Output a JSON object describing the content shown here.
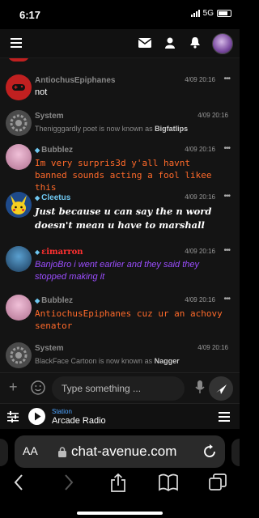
{
  "status_bar": {
    "time": "6:17",
    "network": "5G"
  },
  "header": {
    "menu_icon": "hamburger-icon",
    "icons": [
      "mail-icon",
      "user-icon",
      "bell-icon"
    ],
    "avatar": "user-avatar"
  },
  "messages": [
    {
      "name": "AntiochusEpiphanes",
      "time": "4/09 20:16",
      "text": "not",
      "text_color": "#ffffff",
      "avatar_color": "#c02020",
      "gem": false
    },
    {
      "name": "System",
      "time": "4/09 20:16",
      "text": "Thenigggardly poet is now known as ",
      "text_bold": "Bigfatlips",
      "text_color": "#8a8a8a",
      "avatar_color": "#555555",
      "gem": false
    },
    {
      "name": "Bubblez",
      "time": "4/09 20:16",
      "text": "Im very surpris3d y'all havnt banned sounds acting a fool likee this",
      "text_color": "#ff6a2a",
      "avatar_color": "#d8a0c0",
      "gem": true
    },
    {
      "name": "Cleetus",
      "time": "4/09 20:16",
      "text": "Just because u can say the n word doesn't mean u have to marshall",
      "text_color": "#ffffff",
      "avatar_color": "#f5d020",
      "gem": true
    },
    {
      "name": "εimarron",
      "time": "4/09 20:16",
      "text": "BanjoBro i went earlier and they said they stopped making it",
      "text_color": "#9b4dff",
      "avatar_color": "#2a6fa0",
      "gem": true,
      "name_color": "#ff3030"
    },
    {
      "name": "Bubblez",
      "time": "4/09 20:16",
      "text": "AntiochusEpiphanes cuz ur an achovy senator",
      "text_color": "#ff6a2a",
      "avatar_color": "#d8a0c0",
      "gem": true
    },
    {
      "name": "System",
      "time": "4/09 20:16",
      "text": "BlackFace Cartoon is now known as ",
      "text_bold": "Nagger",
      "text_color": "#8a8a8a",
      "avatar_color": "#555555",
      "gem": false
    }
  ],
  "input": {
    "placeholder": "Type something ..."
  },
  "player": {
    "label": "Station",
    "station": "Arcade Radio"
  },
  "browser": {
    "aa": "AA",
    "url": "chat-avenue.com"
  },
  "colors": {
    "accent": "#4da3ff",
    "background": "#141414"
  }
}
